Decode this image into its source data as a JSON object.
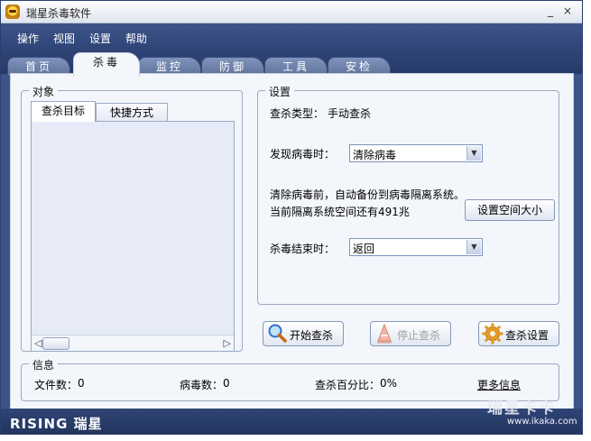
{
  "window": {
    "title": "瑞星杀毒软件",
    "minimize": "_",
    "close": "×"
  },
  "menu": [
    "操作",
    "视图",
    "设置",
    "帮助"
  ],
  "tabs": [
    "首页",
    "杀毒",
    "监控",
    "防御",
    "工具",
    "安检"
  ],
  "active_tab": "杀毒",
  "object_panel": {
    "title": "对象",
    "tabs": [
      "查杀目标",
      "快捷方式"
    ],
    "scroll_left": "◁",
    "scroll_right": "▷"
  },
  "settings": {
    "title": "设置",
    "scan_type_label": "查杀类型：",
    "scan_type_value": "手动查杀",
    "on_virus_label": "发现病毒时：",
    "on_virus_value": "清除病毒",
    "backup_note": "清除病毒前，自动备份到病毒隔离系统。",
    "space_note": "当前隔离系统空间还有491兆",
    "set_space_button": "设置空间大小",
    "on_finish_label": "杀毒结束时：",
    "on_finish_value": "返回"
  },
  "actions": {
    "start": "开始查杀",
    "stop": "停止查杀",
    "config": "查杀设置"
  },
  "info": {
    "title": "信息",
    "files_label": "文件数：",
    "files_value": "0",
    "virus_label": "病毒数：",
    "virus_value": "0",
    "percent_label": "查杀百分比：",
    "percent_value": "0%",
    "more": "更多信息"
  },
  "brand": {
    "logo_text": "RISING 瑞星"
  },
  "watermark": {
    "line1": "瑞星卡卡",
    "line2": "www.ikaka.com"
  },
  "colors": {
    "frame": "#3d5488",
    "panel": "#f3f6fb",
    "accent": "#7f93bd"
  }
}
